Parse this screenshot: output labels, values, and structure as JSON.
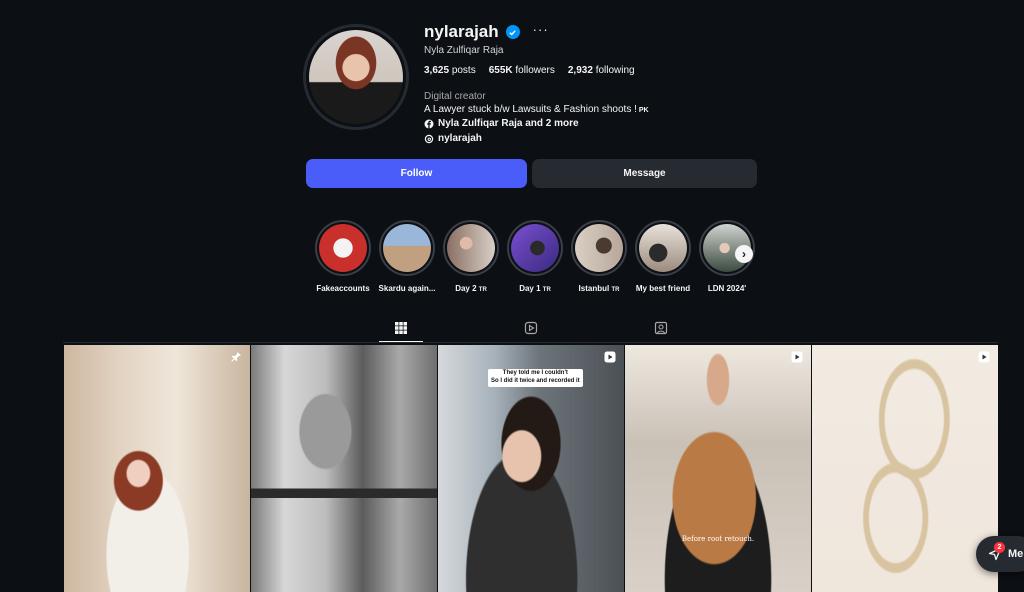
{
  "profile": {
    "username": "nylarajah",
    "more": "···",
    "full_name": "Nyla Zulfiqar Raja",
    "stats": {
      "posts_value": "3,625",
      "posts_label": "posts",
      "followers_value": "655K",
      "followers_label": "followers",
      "following_value": "2,932",
      "following_label": "following"
    },
    "category": "Digital creator",
    "bio": "A Lawyer stuck b/w Lawsuits & Fashion shoots !",
    "bio_flag": "PK",
    "facebook_link": "Nyla Zulfiqar Raja and 2 more",
    "threads_link": "nylarajah"
  },
  "actions": {
    "follow_label": "Follow",
    "message_label": "Message"
  },
  "highlights": [
    {
      "label": "Fakeaccounts",
      "suffix": "",
      "color": "#c9302c"
    },
    {
      "label": "Skardu again...",
      "suffix": "",
      "color": "#6e8fb8"
    },
    {
      "label": "Day 2",
      "suffix": "TR",
      "color": "#8a6f63"
    },
    {
      "label": "Day 1",
      "suffix": "TR",
      "color": "#5a3fa0"
    },
    {
      "label": "Istanbul",
      "suffix": "TR",
      "color": "#b7a79a"
    },
    {
      "label": "My best friend",
      "suffix": "",
      "color": "#9c8b7e"
    },
    {
      "label": "LDN 2024'",
      "suffix": "",
      "color": "#3c4a3f"
    }
  ],
  "tabs": [
    "posts-grid",
    "reels",
    "tagged"
  ],
  "posts": [
    {
      "type": "pinned",
      "overlay_text": "",
      "caption": ""
    },
    {
      "type": "image",
      "overlay_text": "",
      "caption": ""
    },
    {
      "type": "reel",
      "overlay_text": "They told me I couldn't\nSo I did it twice and recorded it",
      "caption": ""
    },
    {
      "type": "reel",
      "overlay_text": "",
      "caption": "Before root retouch."
    },
    {
      "type": "reel",
      "overlay_text": "",
      "caption": ""
    }
  ],
  "messages_widget": {
    "label": "Me",
    "unread_count": "2"
  },
  "colors": {
    "background": "#0c0f14",
    "follow_button": "#4a5df9",
    "secondary_button": "#262a31",
    "verified": "#0095f6"
  }
}
